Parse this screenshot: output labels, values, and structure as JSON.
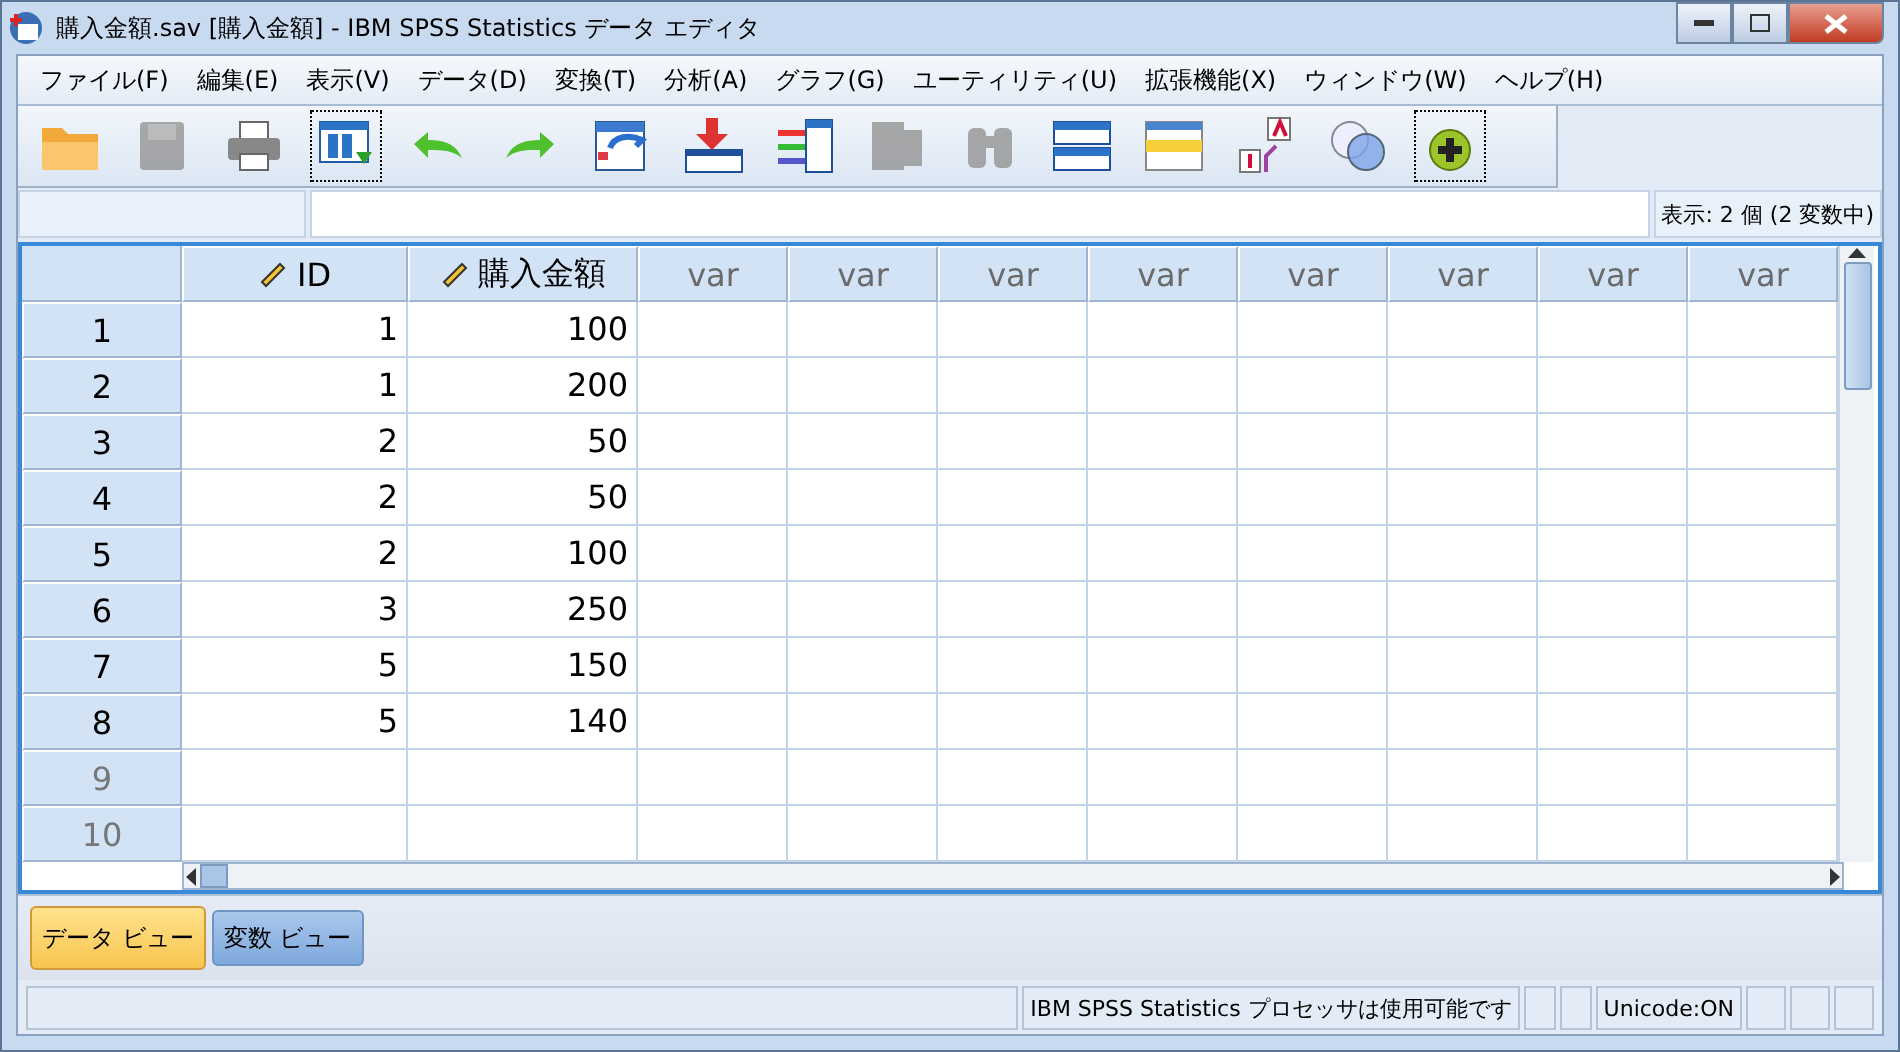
{
  "window": {
    "title": "購入金額.sav [購入金額] - IBM SPSS Statistics データ エディタ"
  },
  "menu": [
    "ファイル(F)",
    "編集(E)",
    "表示(V)",
    "データ(D)",
    "変換(T)",
    "分析(A)",
    "グラフ(G)",
    "ユーティリティ(U)",
    "拡張機能(X)",
    "ウィンドウ(W)",
    "ヘルプ(H)"
  ],
  "toolbar": [
    {
      "kind": "open",
      "disabled": false
    },
    {
      "kind": "save",
      "disabled": true
    },
    {
      "kind": "print",
      "disabled": false
    },
    {
      "kind": "dialog",
      "disabled": false
    },
    {
      "kind": "undo",
      "disabled": false
    },
    {
      "kind": "redo",
      "disabled": false
    },
    {
      "kind": "goto-case",
      "disabled": false
    },
    {
      "kind": "insert-case",
      "disabled": false
    },
    {
      "kind": "variables",
      "disabled": false
    },
    {
      "kind": "goto-var",
      "disabled": true
    },
    {
      "kind": "find",
      "disabled": true
    },
    {
      "kind": "split",
      "disabled": false
    },
    {
      "kind": "grid",
      "disabled": false
    },
    {
      "kind": "labels",
      "disabled": false
    },
    {
      "kind": "sets",
      "disabled": false
    },
    {
      "kind": "extension",
      "disabled": false
    }
  ],
  "cell_bar": {
    "display": "表示: 2 個 (2 変数中)"
  },
  "table": {
    "columns": [
      {
        "label": "ID",
        "kind": "variable"
      },
      {
        "label": "購入金額",
        "kind": "variable"
      },
      {
        "label": "var",
        "kind": "empty"
      },
      {
        "label": "var",
        "kind": "empty"
      },
      {
        "label": "var",
        "kind": "empty"
      },
      {
        "label": "var",
        "kind": "empty"
      },
      {
        "label": "var",
        "kind": "empty"
      },
      {
        "label": "var",
        "kind": "empty"
      },
      {
        "label": "var",
        "kind": "empty"
      },
      {
        "label": "var",
        "kind": "empty"
      }
    ],
    "rows": [
      {
        "number": "1",
        "empty": false,
        "cells": [
          "1",
          "100"
        ]
      },
      {
        "number": "2",
        "empty": false,
        "cells": [
          "1",
          "200"
        ]
      },
      {
        "number": "3",
        "empty": false,
        "cells": [
          "2",
          "50"
        ]
      },
      {
        "number": "4",
        "empty": false,
        "cells": [
          "2",
          "50"
        ]
      },
      {
        "number": "5",
        "empty": false,
        "cells": [
          "2",
          "100"
        ]
      },
      {
        "number": "6",
        "empty": false,
        "cells": [
          "3",
          "250"
        ]
      },
      {
        "number": "7",
        "empty": false,
        "cells": [
          "5",
          "150"
        ]
      },
      {
        "number": "8",
        "empty": false,
        "cells": [
          "5",
          "140"
        ]
      },
      {
        "number": "9",
        "empty": true,
        "cells": []
      },
      {
        "number": "10",
        "empty": true,
        "cells": []
      }
    ]
  },
  "tabs": [
    {
      "label": "データ ビュー",
      "selected": true
    },
    {
      "label": "変数 ビュー",
      "selected": false
    }
  ],
  "status_bar": {
    "processor": "IBM SPSS Statistics プロセッサは使用可能です",
    "unicode": "Unicode:ON"
  }
}
